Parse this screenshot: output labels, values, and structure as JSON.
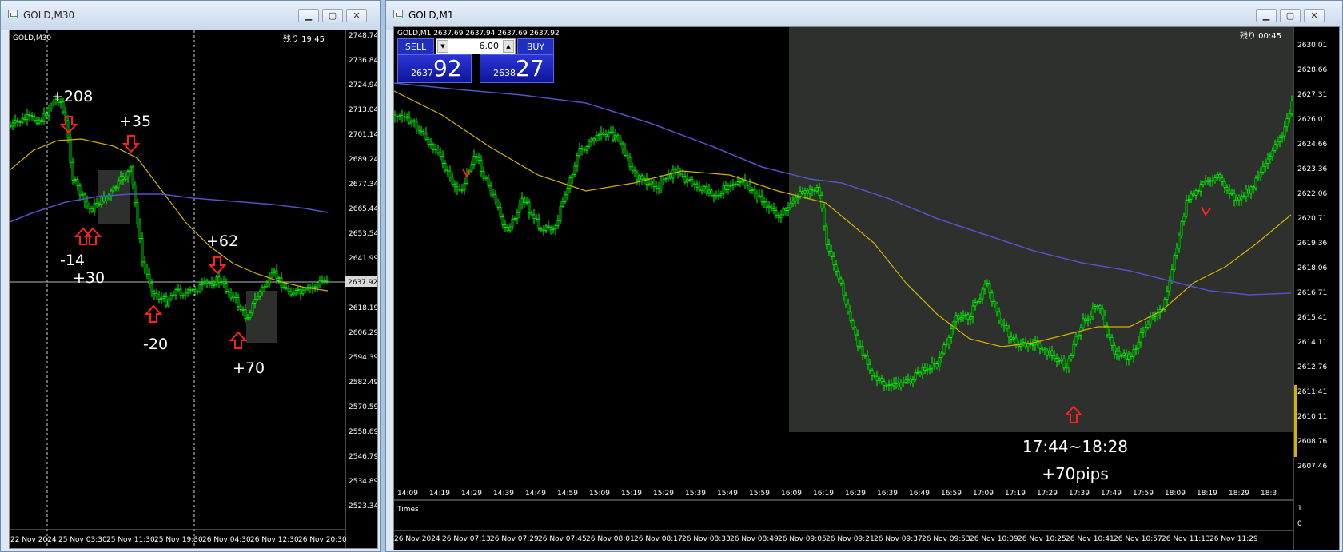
{
  "left_window": {
    "title": "GOLD,M30",
    "chart_label": "GOLD,M30",
    "remaining": "残り 19:45",
    "current_price": "2637.92",
    "price_axis": [
      "2748.74",
      "2736.84",
      "2724.94",
      "2713.04",
      "2701.14",
      "2689.24",
      "2677.34",
      "2665.44",
      "2653.54",
      "2641.99",
      "2630.09",
      "2618.19",
      "2606.29",
      "2594.39",
      "2582.49",
      "2570.59",
      "2558.69",
      "2546.79",
      "2534.89",
      "2523.34"
    ],
    "time_axis": [
      "22 Nov 2024",
      "25 Nov 03:30",
      "25 Nov 11:30",
      "25 Nov 19:30",
      "26 Nov 04:30",
      "26 Nov 12:30",
      "26 Nov 20:30"
    ],
    "annotations": [
      "+208",
      "+35",
      "-14",
      "+30",
      "+62",
      "-20",
      "+70"
    ]
  },
  "right_window": {
    "title": "GOLD,M1",
    "chart_label": "GOLD,M1  2637.69  2637.94  2637.69  2637.92",
    "remaining": "残り 00:45",
    "trade": {
      "sell_label": "SELL",
      "buy_label": "BUY",
      "lot": "6.00",
      "sell_small": "2637",
      "sell_big": "92",
      "buy_small": "2638",
      "buy_big": "27"
    },
    "price_axis": [
      "2630.01",
      "2628.66",
      "2627.31",
      "2626.01",
      "2624.66",
      "2623.36",
      "2622.06",
      "2620.71",
      "2619.36",
      "2618.06",
      "2616.71",
      "2615.41",
      "2614.11",
      "2612.76",
      "2611.41",
      "2610.11",
      "2608.76",
      "2607.46"
    ],
    "sub_time_axis": [
      "14:09",
      "14:19",
      "14:29",
      "14:39",
      "14:49",
      "14:59",
      "15:09",
      "15:19",
      "15:29",
      "15:39",
      "15:49",
      "15:59",
      "16:09",
      "16:19",
      "16:29",
      "16:39",
      "16:49",
      "16:59",
      "17:09",
      "17:19",
      "17:29",
      "17:39",
      "17:49",
      "17:59",
      "18:09",
      "18:19",
      "18:29",
      "18:3"
    ],
    "sub_label": "Times",
    "sub_axis": [
      "1",
      "0"
    ],
    "time_axis": [
      "26 Nov 2024",
      "26 Nov 07:13",
      "26 Nov 07:29",
      "26 Nov 07:45",
      "26 Nov 08:01",
      "26 Nov 08:17",
      "26 Nov 08:33",
      "26 Nov 08:49",
      "26 Nov 09:05",
      "26 Nov 09:21",
      "26 Nov 09:37",
      "26 Nov 09:53",
      "26 Nov 10:09",
      "26 Nov 10:25",
      "26 Nov 10:41",
      "26 Nov 10:57",
      "26 Nov 11:13",
      "26 Nov 11:29"
    ],
    "range_text": "17:44~18:28",
    "pips_text": "+70pips"
  },
  "colors": {
    "candle": "#00ff00",
    "ma_fast": "#d4b300",
    "ma_slow": "#5552c8",
    "arrow": "#ff2020",
    "shade": "#2e302d",
    "grid_text": "#ffffff"
  }
}
